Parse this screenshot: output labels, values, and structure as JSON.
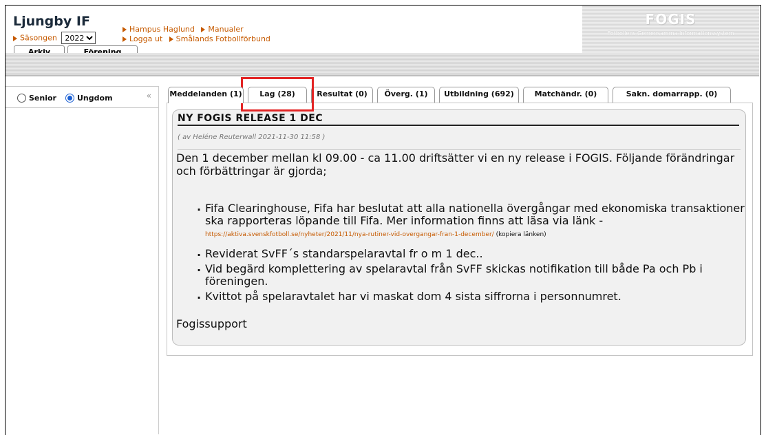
{
  "header": {
    "club_name": "Ljungby IF",
    "season_label": "Säsongen",
    "season_value": "2022",
    "links_row1": [
      "Hampus Haglund",
      "Manualer"
    ],
    "links_row2": [
      "Logga ut",
      "Smålands Fotbollförbund"
    ],
    "main_tabs": [
      "Arkiv",
      "Förening"
    ]
  },
  "logo": {
    "title": "FOGIS",
    "subtitle": "Fotbollens Gemensamma Informationssystem"
  },
  "sidebar": {
    "options": [
      {
        "label": "Senior",
        "selected": false
      },
      {
        "label": "Ungdom",
        "selected": true
      }
    ],
    "collapse_symbol": "«"
  },
  "tabs": [
    "Meddelanden (1)",
    "Lag (28)",
    "Resultat (0)",
    "Överg. (1)",
    "Utbildning (692)",
    "Matchändr. (0)",
    "Sakn. domarrapp. (0)"
  ],
  "message": {
    "title": "NY FOGIS RELEASE 1 DEC",
    "meta": "( av  Heléne Reuterwall  2021-11-30 11:58 )",
    "intro": "Den 1 december mellan kl 09.00 - ca 11.00 driftsätter vi en ny release i FOGIS. Följande förändringar och förbättringar är gjorda;",
    "bullets": [
      "Fifa Clearinghouse, Fifa har beslutat att alla nationella övergångar med ekonomiska transaktioner ska rapporteras löpande till Fifa. Mer information finns att läsa via länk -",
      "Reviderat SvFF´s standarspelaravtal fr o m 1 dec..",
      "Vid begärd komplettering av spelaravtal från SvFF skickas notifikation till både Pa och Pb i föreningen.",
      "Kvittot på spelaravtalet har vi maskat dom 4 sista siffrorna i personnumret."
    ],
    "link_url": "https://aktiva.svenskfotboll.se/nyheter/2021/11/nya-rutiner-vid-overgangar-fran-1-december/",
    "link_note": "(kopiera länken)",
    "signature": "Fogissupport"
  }
}
